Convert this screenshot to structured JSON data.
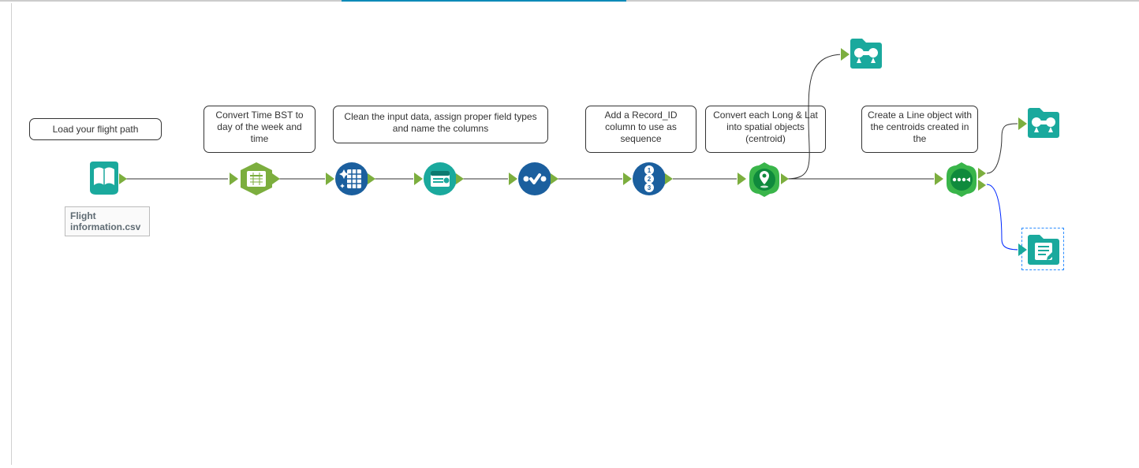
{
  "annotations": {
    "a1": "Load your flight path",
    "a2": "Convert Time BST to day of the week and time",
    "a3": "Clean the input data, assign proper field types and name the columns",
    "a4": "Add a Record_ID column to use as sequence",
    "a5": "Convert each Long & Lat into spatial objects (centroid)",
    "a6": "Create a Line object with the centroids created in the"
  },
  "file_label": "Flight information.csv",
  "colors": {
    "teal": "#1aa99d",
    "green": "#7cae3e",
    "blue": "#1b5f9e",
    "brightGreen": "#39b54a",
    "tabActive": "#0d8ab8"
  }
}
